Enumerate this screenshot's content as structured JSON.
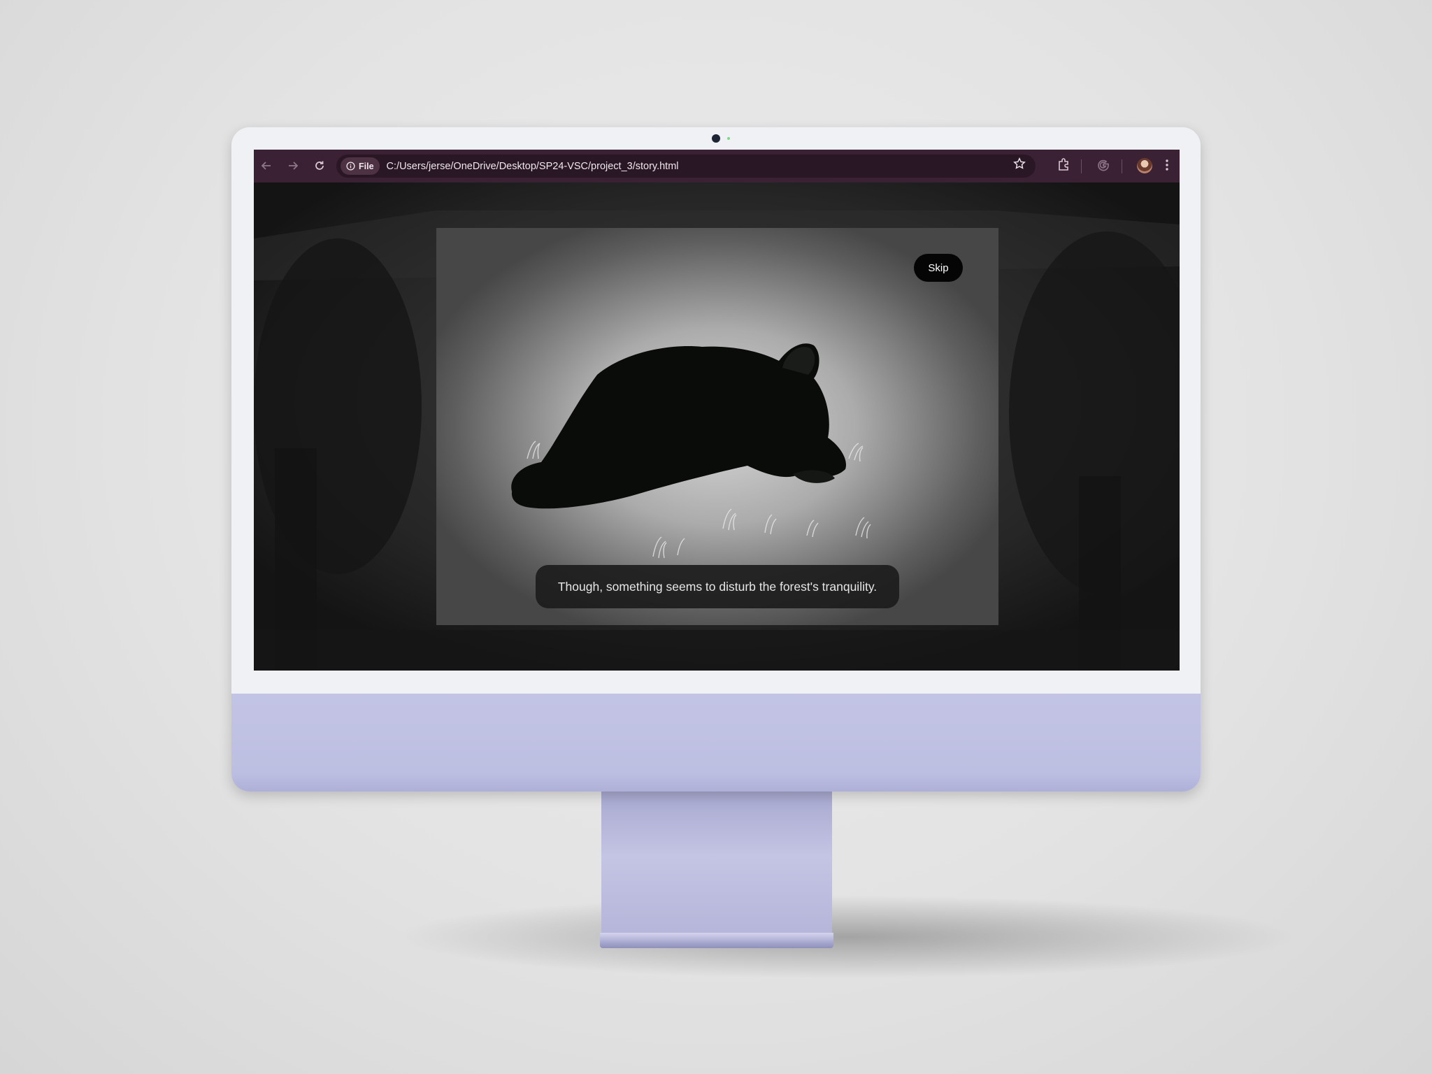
{
  "browser": {
    "url_chip_label": "File",
    "url": "C:/Users/jerse/OneDrive/Desktop/SP24-VSC/project_3/story.html",
    "icons": [
      "back-arrow-icon",
      "forward-arrow-icon",
      "reload-icon",
      "info-icon",
      "star-icon",
      "extensions-icon",
      "google-icon",
      "avatar",
      "kebab-menu-icon"
    ]
  },
  "story": {
    "skip_label": "Skip",
    "caption": "Though, something seems to disturb the forest's tranquility."
  },
  "colors": {
    "toolbar": "#3a2133",
    "omnibox": "#2a1725",
    "imac_chin": "#bdbfe2",
    "imac_bezel": "#f0f1f4",
    "skip_button": "#050505"
  }
}
